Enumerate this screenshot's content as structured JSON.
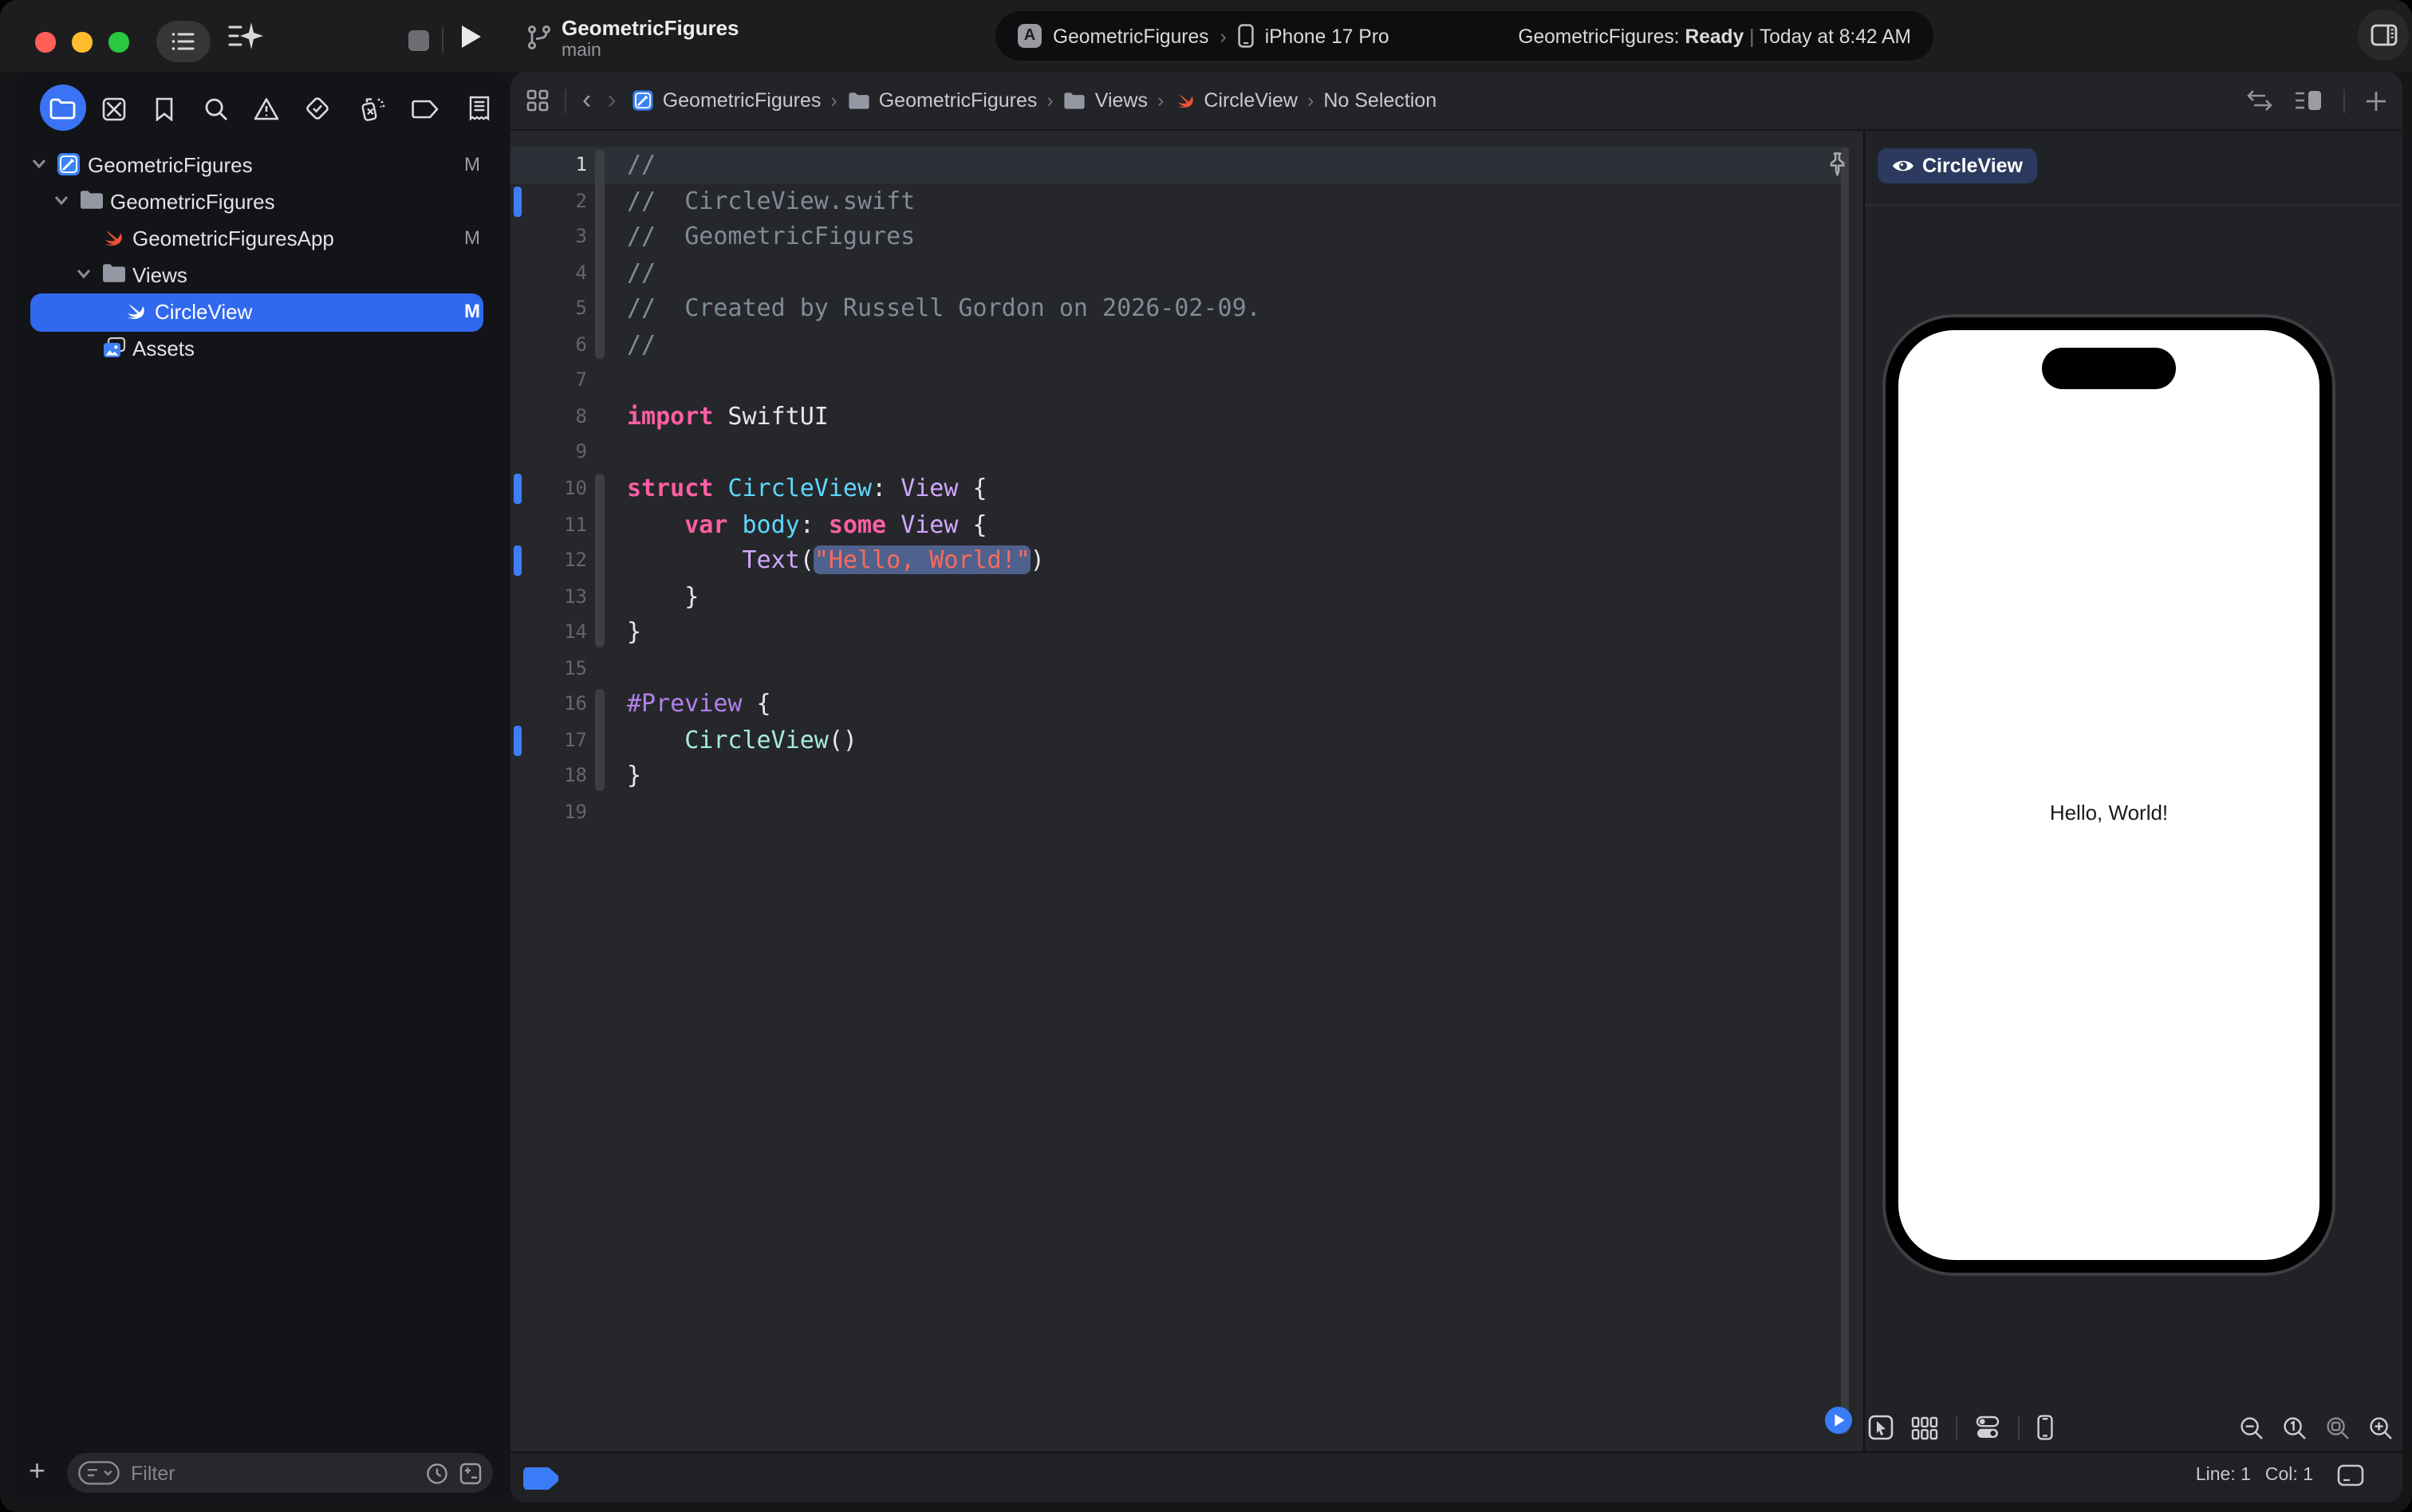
{
  "window": {
    "title": "GeometricFigures",
    "branch": "main"
  },
  "titlebar": {
    "scheme": {
      "project": "GeometricFigures",
      "chevron": "›",
      "device": "iPhone 17 Pro"
    },
    "status": {
      "project": "GeometricFigures:",
      "state": "Ready",
      "divider": "|",
      "time": "Today at 8:42 AM"
    },
    "icons": [
      "sidebar-list-icon",
      "ai-sparkle-icon",
      "stop-icon",
      "run-icon",
      "branch-icon",
      "inspector-panel-icon"
    ]
  },
  "navigator": {
    "selected_index": 0,
    "tabs": [
      "project-navigator",
      "source-control",
      "bookmarks",
      "find",
      "issues",
      "tests",
      "debug",
      "breakpoints",
      "reports"
    ]
  },
  "sidebar": {
    "tree": [
      {
        "label": "GeometricFigures",
        "icon": "project",
        "level": 0,
        "chevron": true,
        "badge": "M"
      },
      {
        "label": "GeometricFigures",
        "icon": "folder",
        "level": 1,
        "chevron": true,
        "badge": ""
      },
      {
        "label": "GeometricFiguresApp",
        "icon": "swift",
        "level": 2,
        "chevron": false,
        "badge": "M"
      },
      {
        "label": "Views",
        "icon": "folder",
        "level": 2,
        "chevron": true,
        "badge": ""
      },
      {
        "label": "CircleView",
        "icon": "swift-white",
        "level": 3,
        "chevron": false,
        "badge": "M",
        "selected": true
      },
      {
        "label": "Assets",
        "icon": "assets",
        "level": 2,
        "chevron": false,
        "badge": ""
      }
    ],
    "filter": {
      "placeholder": "Filter",
      "add_label": "+"
    }
  },
  "jumpbar": {
    "separator": "›",
    "back": "‹",
    "forward": "›",
    "crumbs": [
      {
        "icon": "project",
        "label": "GeometricFigures"
      },
      {
        "icon": "folder",
        "label": "GeometricFigures"
      },
      {
        "icon": "folder",
        "label": "Views"
      },
      {
        "icon": "swift",
        "label": "CircleView"
      },
      {
        "icon": null,
        "label": "No Selection"
      }
    ]
  },
  "editor": {
    "current_line": 1,
    "changed_lines": [
      2,
      10,
      12,
      17
    ],
    "ribbon_segments": [
      {
        "from": 1,
        "to": 6
      },
      {
        "from": 10,
        "to": 14
      },
      {
        "from": 16,
        "to": 18
      }
    ],
    "lines": [
      {
        "n": 1,
        "tokens": [
          [
            "cm",
            "//"
          ]
        ]
      },
      {
        "n": 2,
        "tokens": [
          [
            "cm",
            "//  CircleView.swift"
          ]
        ]
      },
      {
        "n": 3,
        "tokens": [
          [
            "cm",
            "//  GeometricFigures"
          ]
        ]
      },
      {
        "n": 4,
        "tokens": [
          [
            "cm",
            "//"
          ]
        ]
      },
      {
        "n": 5,
        "tokens": [
          [
            "cm",
            "//  Created by Russell Gordon on 2026-02-09."
          ]
        ]
      },
      {
        "n": 6,
        "tokens": [
          [
            "cm",
            "//"
          ]
        ]
      },
      {
        "n": 7,
        "tokens": []
      },
      {
        "n": 8,
        "tokens": [
          [
            "kw",
            "import"
          ],
          [
            "pl",
            " SwiftUI"
          ]
        ]
      },
      {
        "n": 9,
        "tokens": []
      },
      {
        "n": 10,
        "tokens": [
          [
            "kw",
            "struct"
          ],
          [
            "pl",
            " "
          ],
          [
            "ty",
            "CircleView"
          ],
          [
            "pl",
            ": "
          ],
          [
            "pt",
            "View"
          ],
          [
            "pl",
            " {"
          ]
        ]
      },
      {
        "n": 11,
        "tokens": [
          [
            "pl",
            "    "
          ],
          [
            "kw",
            "var"
          ],
          [
            "pl",
            " "
          ],
          [
            "ty",
            "body"
          ],
          [
            "pl",
            ": "
          ],
          [
            "kw",
            "some"
          ],
          [
            "pl",
            " "
          ],
          [
            "pt",
            "View"
          ],
          [
            "pl",
            " {"
          ]
        ]
      },
      {
        "n": 12,
        "tokens": [
          [
            "pl",
            "        "
          ],
          [
            "pt",
            "Text"
          ],
          [
            "pl",
            "("
          ],
          [
            "sel",
            "\"Hello, World!\""
          ],
          [
            "pl",
            ")"
          ]
        ]
      },
      {
        "n": 13,
        "tokens": [
          [
            "pl",
            "    }"
          ]
        ]
      },
      {
        "n": 14,
        "tokens": [
          [
            "pl",
            "}"
          ]
        ]
      },
      {
        "n": 15,
        "tokens": []
      },
      {
        "n": 16,
        "tokens": [
          [
            "mc",
            "#Preview"
          ],
          [
            "pl",
            " {"
          ]
        ]
      },
      {
        "n": 17,
        "tokens": [
          [
            "pl",
            "    "
          ],
          [
            "fn",
            "CircleView"
          ],
          [
            "pl",
            "()"
          ]
        ]
      },
      {
        "n": 18,
        "tokens": [
          [
            "pl",
            "}"
          ]
        ]
      },
      {
        "n": 19,
        "tokens": []
      }
    ]
  },
  "canvas": {
    "tab": "CircleView",
    "phone_text": "Hello, World!",
    "toolbar_icons": [
      "live-preview-play",
      "selectable-mode",
      "variants-grid",
      "device-settings",
      "device-iphone",
      "zoom-out",
      "zoom-100",
      "zoom-fit",
      "zoom-in"
    ]
  },
  "statusbar": {
    "line_label": "Line: 1",
    "col_label": "Col: 1"
  },
  "colors": {
    "accent_blue": "#3a74f4",
    "selection_row": "#3069ef",
    "change_marker": "#3d7ef8",
    "traffic_red": "#ff5f57",
    "traffic_yellow": "#febc2e",
    "traffic_green": "#28c840",
    "editor_bg": "#26272b",
    "sidebar_bg": "#131418",
    "canvas_bg": "#212227",
    "syntax_comment": "#7f8c98",
    "syntax_keyword": "#fc5fa3",
    "syntax_decl": "#5dd8ff",
    "syntax_type": "#d0a8ff",
    "syntax_string": "#fc6a5d",
    "syntax_macro": "#b281eb",
    "syntax_project_type": "#a7ebdd",
    "string_highlight": "#4f618c",
    "preview_tab_bg": "#2b3a5e",
    "swift_orange": "#f05138"
  }
}
